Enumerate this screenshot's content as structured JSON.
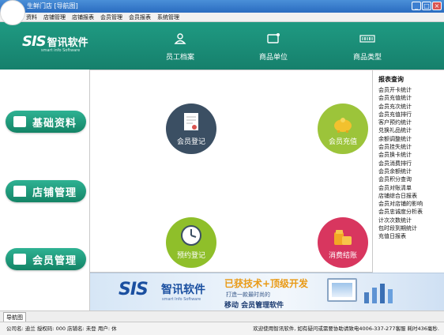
{
  "window": {
    "title": "生鲜门店 [导航图]",
    "buttons": [
      "_",
      "□",
      "×"
    ]
  },
  "menu": [
    "资料",
    "店铺管理",
    "店铺报表",
    "会员管理",
    "会员报表",
    "系统管理"
  ],
  "brand": {
    "logo": "SIS",
    "name": "智讯软件",
    "subtitle": "smart info Software"
  },
  "nav": [
    {
      "label": "员工档案",
      "icon": "person-icon"
    },
    {
      "label": "商品单位",
      "icon": "message-icon"
    },
    {
      "label": "商品类型",
      "icon": "barcode-icon"
    }
  ],
  "sidebar": [
    {
      "label": "基础资料",
      "icon": "edit-icon"
    },
    {
      "label": "店铺管理",
      "icon": "home-icon"
    },
    {
      "label": "会员管理",
      "icon": "card-icon"
    }
  ],
  "tiles": [
    {
      "label": "会员登记",
      "icon": "certificate-icon",
      "color": "#3b4f63"
    },
    {
      "label": "会员充值",
      "icon": "piggy-bank-icon",
      "color": "#9cc43a"
    },
    {
      "label": "预约登记",
      "icon": "clock-icon",
      "color": "#8fbf2a"
    },
    {
      "label": "消费结账",
      "icon": "coins-icon",
      "color": "#d8365f"
    }
  ],
  "report": {
    "title": "报表查询",
    "items": [
      "会员开卡统计",
      "会员充值统计",
      "会员充次统计",
      "会员充值排行",
      "客户预约统计",
      "兑换礼品统计",
      "余额调整统计",
      "会员挂失统计",
      "会员换卡统计",
      "会员消费排行",
      "会员余额统计",
      "会员积分查询",
      "会员对账清单",
      "店铺综合日报表",
      "会员对店铺的影响",
      "会员忠诚度分析表",
      "计次次数统计",
      "包时段到期统计",
      "充值日报表"
    ]
  },
  "banner": {
    "logo": "SIS",
    "name": "智讯软件",
    "subtitle": "smart Info Software",
    "slogan_main": "已获技术+顶级开发",
    "slogan_sub": "打造一款最时尚的",
    "slogan_tag": "移动 会员管理软件"
  },
  "tab_label": "导航图",
  "status": {
    "left": "公司名: 迪兰  授权码: 000  店铺名: 未登  用户: 休",
    "right": "欢迎使用智讯软件, 如有疑问或需要协助请致电4006-337-277客服 耗时436毫秒."
  },
  "colors": {
    "header": "#1f9a82",
    "sidebar_button": "#1f9a7a",
    "title_bar": "#3a7dd0"
  }
}
